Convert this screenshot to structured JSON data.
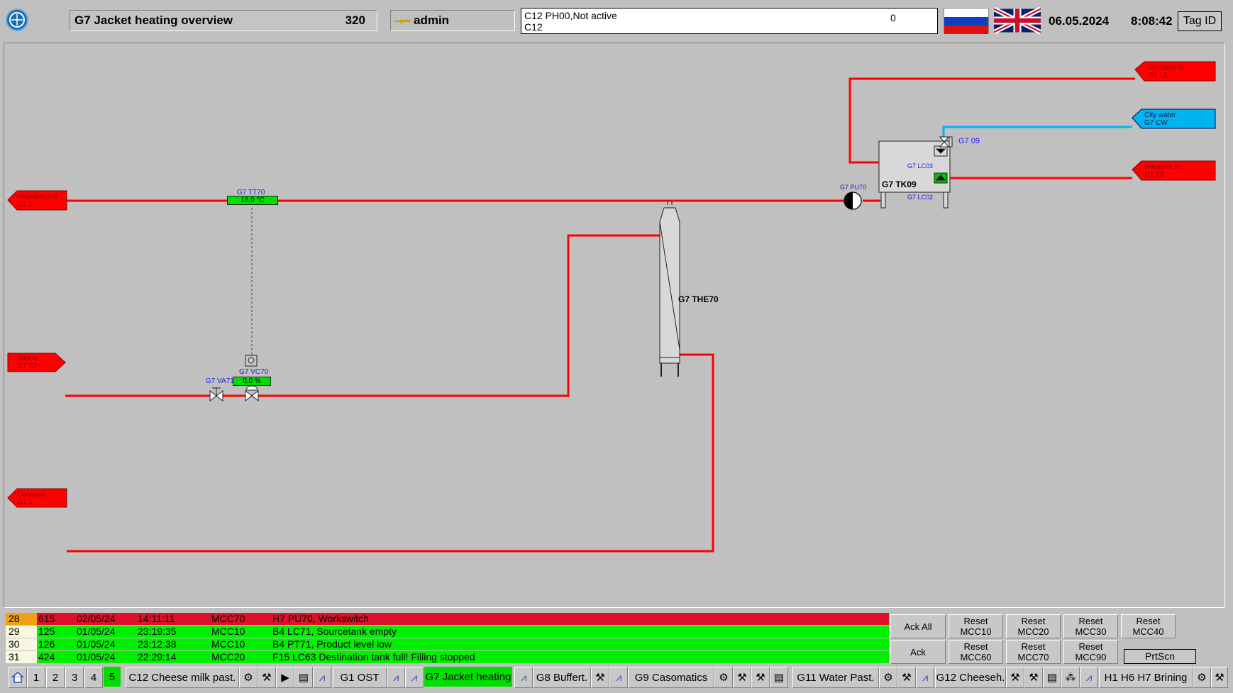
{
  "header": {
    "title": "G7 Jacket heating overview",
    "screen_number": "320",
    "user": "admin",
    "alarm_line1": "C12 PH00,Not active",
    "alarm_line2": "C12",
    "alarm_count": "0",
    "date": "06.05.2024",
    "time": "8:08:42",
    "tag_id_label": "Tag ID"
  },
  "process": {
    "endpoints": {
      "hotwater_in_top": [
        "Hotwater in",
        "G1 13"
      ],
      "city_water": [
        "City water",
        "G7 CW"
      ],
      "hotwater_in_mid": [
        "Hotwater in",
        "G1 13"
      ],
      "hotwater_out": [
        "Hotwater out",
        "G7 1"
      ],
      "steam": [
        "Steam",
        "G7 ST+"
      ],
      "condens": [
        "Condens",
        "G7 1"
      ]
    },
    "tt70_label": "G7 TT70",
    "tt70_value": "18,0 °C",
    "vc70_label": "G7 VC70",
    "vc70_value": "0,0 %",
    "va71_label": "G7 VA71",
    "hx_label": "G7 THE70",
    "tank_label": "G7 TK09",
    "lc03_label": "G7 LC03",
    "lc02_label": "G7 LC02",
    "pu70_label": "G7 PU70",
    "valve09_label": "G7 09"
  },
  "alarms": [
    {
      "idx": "28",
      "code": "615",
      "date": "02/05/24",
      "time": "14:11:11",
      "mcc": "MCC70",
      "text": "H7 PU70, Workswitch",
      "state": "active"
    },
    {
      "idx": "29",
      "code": "125",
      "date": "01/05/24",
      "time": "23:19:35",
      "mcc": "MCC10",
      "text": "B4 LC71, Sourcetank empty",
      "state": "ok"
    },
    {
      "idx": "30",
      "code": "126",
      "date": "01/05/24",
      "time": "23:12:38",
      "mcc": "MCC10",
      "text": "B4 PT71, Product level low",
      "state": "ok"
    },
    {
      "idx": "31",
      "code": "424",
      "date": "01/05/24",
      "time": "22:29:14",
      "mcc": "MCC20",
      "text": "F15 LC63 Destination tank full! Filling stopped",
      "state": "ok"
    }
  ],
  "alarm_buttons": {
    "ack_all": "Ack All",
    "ack": "Ack",
    "reset_mcc10": "Reset MCC10",
    "reset_mcc20": "Reset MCC20",
    "reset_mcc30": "Reset MCC30",
    "reset_mcc40": "Reset MCC40",
    "reset_mcc60": "Reset MCC60",
    "reset_mcc70": "Reset MCC70",
    "reset_mcc90": "Reset MCC90",
    "prtscn": "PrtScn"
  },
  "nav": {
    "pages": [
      "1",
      "2",
      "3",
      "4",
      "5"
    ],
    "active_page": "5",
    "c12": "C12 Cheese milk past.",
    "g1": "G1 OST",
    "g7": "G7 Jacket heating",
    "g8": "G8 Buffert.",
    "g9": "G9 Casomatics",
    "g11": "G11 Water Past.",
    "g12": "G12 Cheeseh.",
    "h1": "H1 H6 H7 Brining"
  },
  "colors": {
    "pipe_hot": "#ff0000",
    "pipe_cold": "#00b4f0",
    "value_ok": "#00e000",
    "alarm_active": "#e0102a",
    "alarm_ok": "#00f000"
  }
}
